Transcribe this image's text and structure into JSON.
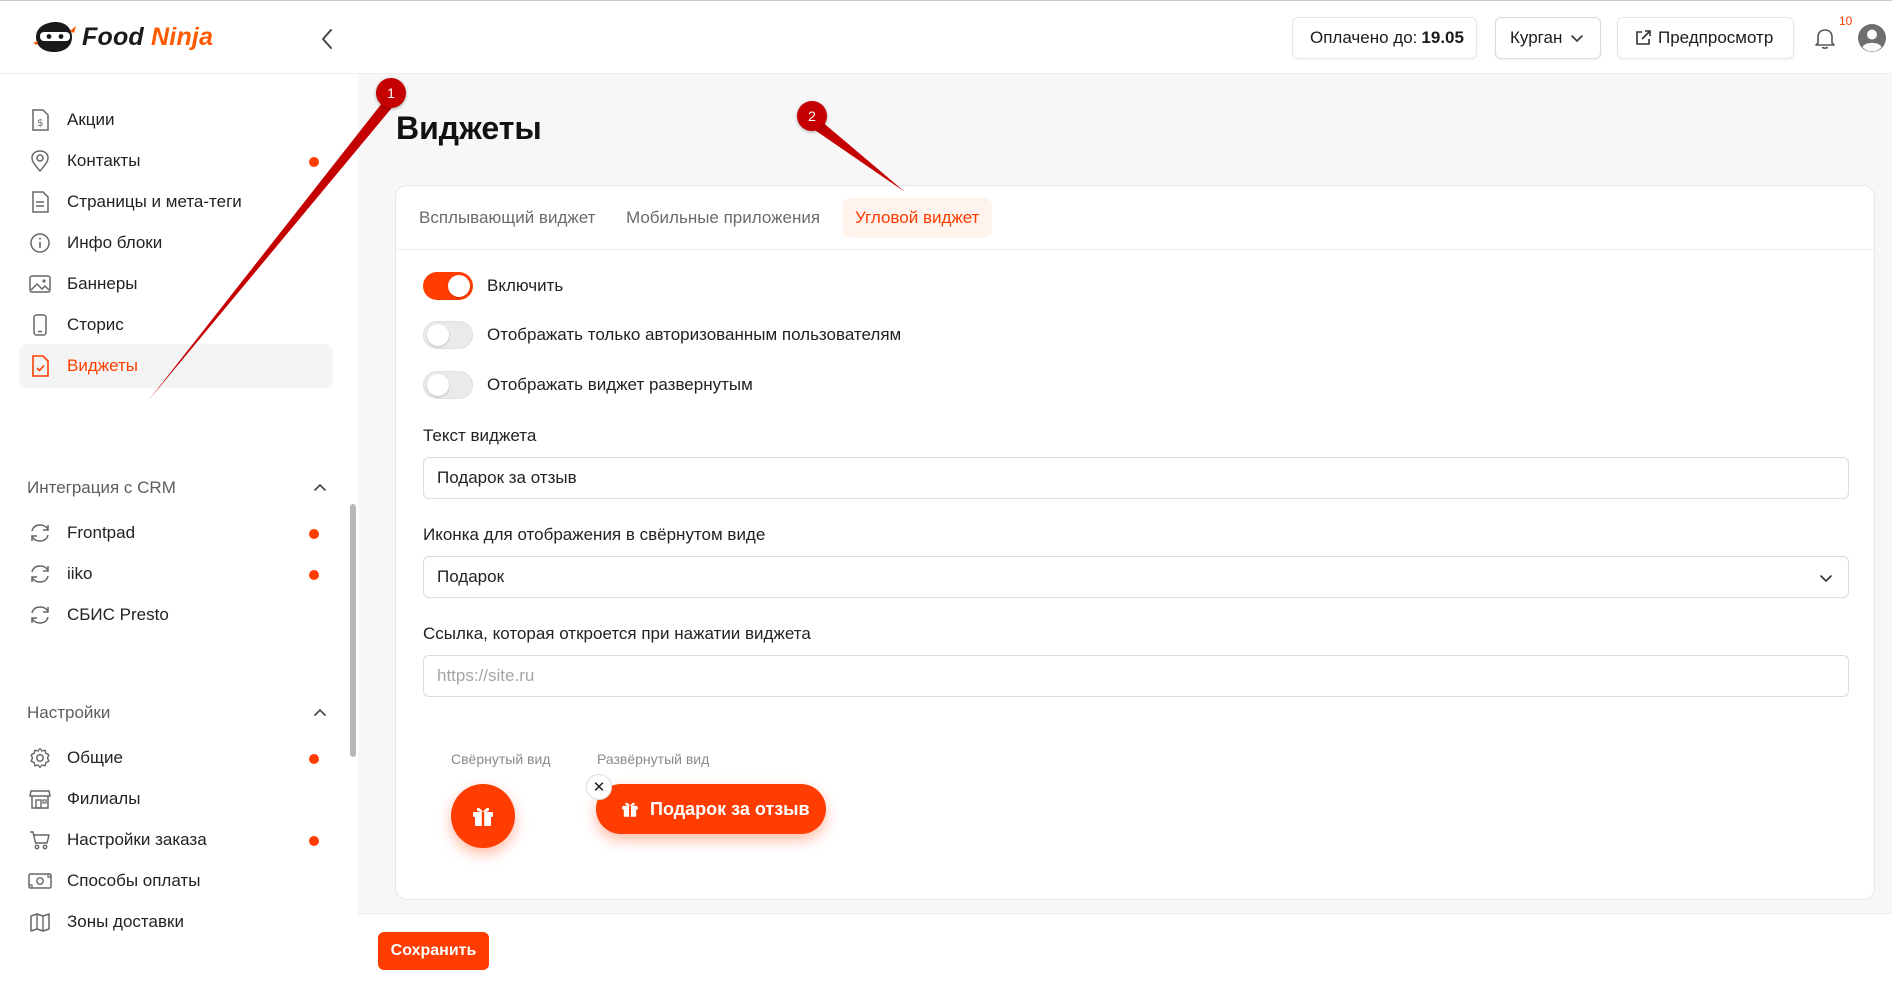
{
  "header": {
    "logo_food": "Food",
    "logo_ninja": "Ninja",
    "paid_label": "Оплачено до:",
    "paid_value": "19.05",
    "city": "Курган",
    "preview_label": "Предпросмотр",
    "notifications_count": "10"
  },
  "sidebar": {
    "items_top": [
      {
        "label": "Акции",
        "icon": "dollar-doc-icon",
        "dot": false
      },
      {
        "label": "Контакты",
        "icon": "location-pin-icon",
        "dot": true
      },
      {
        "label": "Страницы и мета-теги",
        "icon": "document-icon",
        "dot": false
      },
      {
        "label": "Инфо блоки",
        "icon": "info-icon",
        "dot": false
      },
      {
        "label": "Баннеры",
        "icon": "image-icon",
        "dot": false
      },
      {
        "label": "Сторис",
        "icon": "phone-icon",
        "dot": false
      },
      {
        "label": "Виджеты",
        "icon": "doc-check-icon",
        "dot": false,
        "active": true
      }
    ],
    "section_crm": "Интеграция с CRM",
    "items_crm": [
      {
        "label": "Frontpad",
        "icon": "sync-icon",
        "dot": true
      },
      {
        "label": "iiko",
        "icon": "sync-icon",
        "dot": true
      },
      {
        "label": "СБИС Presto",
        "icon": "sync-icon",
        "dot": false
      }
    ],
    "section_settings": "Настройки",
    "items_settings": [
      {
        "label": "Общие",
        "icon": "gear-icon",
        "dot": true
      },
      {
        "label": "Филиалы",
        "icon": "store-icon",
        "dot": false
      },
      {
        "label": "Настройки заказа",
        "icon": "cart-icon",
        "dot": true
      },
      {
        "label": "Способы оплаты",
        "icon": "cash-icon",
        "dot": false
      },
      {
        "label": "Зоны доставки",
        "icon": "map-icon",
        "dot": false
      }
    ]
  },
  "main": {
    "title": "Виджеты",
    "tabs": [
      {
        "label": "Всплывающий виджет",
        "active": false
      },
      {
        "label": "Мобильные приложения",
        "active": false
      },
      {
        "label": "Угловой виджет",
        "active": true
      }
    ],
    "toggles": [
      {
        "label": "Включить",
        "on": true
      },
      {
        "label": "Отображать только авторизованным пользователям",
        "on": false
      },
      {
        "label": "Отображать виджет развернутым",
        "on": false
      }
    ],
    "widget_text_label": "Текст виджета",
    "widget_text_value": "Подарок за отзыв",
    "icon_label": "Иконка для отображения в свёрнутом виде",
    "icon_value": "Подарок",
    "link_label": "Ссылка, которая откроется при нажатии виджета",
    "link_placeholder": "https://site.ru",
    "collapsed_label": "Свёрнутый вид",
    "expanded_label": "Развёрнутый вид",
    "expanded_text": "Подарок за отзыв",
    "close_glyph": "✕"
  },
  "footer": {
    "save_label": "Сохранить"
  },
  "annotations": [
    {
      "number": "1"
    },
    {
      "number": "2"
    }
  ],
  "colors": {
    "accent": "#ff3d00",
    "annotation": "#c40000"
  }
}
